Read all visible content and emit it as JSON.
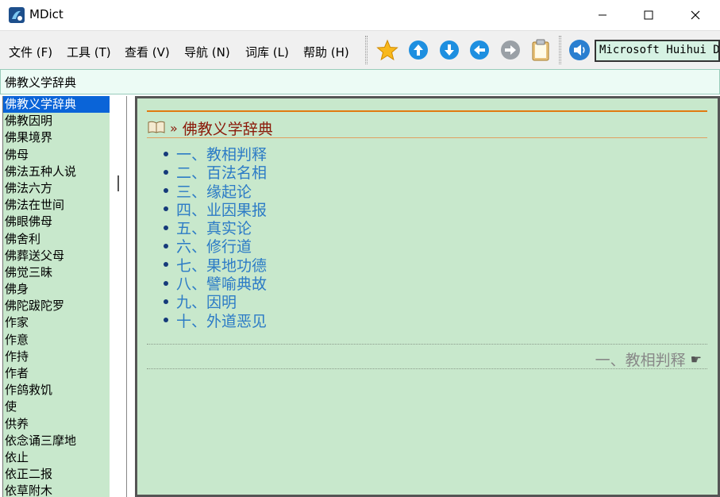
{
  "window": {
    "title": "MDict"
  },
  "menu": [
    {
      "label": "文件 (F)"
    },
    {
      "label": "工具 (T)"
    },
    {
      "label": "查看 (V)"
    },
    {
      "label": "导航 (N)"
    },
    {
      "label": "词库 (L)"
    },
    {
      "label": "帮助 (H)"
    }
  ],
  "toolbar": {
    "voice_value": "Microsoft Huihui Desktop",
    "icons": [
      "star-icon",
      "arrow-up-icon",
      "arrow-down-icon",
      "arrow-left-icon",
      "arrow-right-icon",
      "clipboard-icon",
      "speaker-icon"
    ]
  },
  "search": {
    "value": "佛教义学辞典"
  },
  "word_list": [
    "佛教义学辞典",
    "佛教因明",
    "佛果境界",
    "佛母",
    "佛法五种人说",
    "佛法六方",
    "佛法在世间",
    "佛眼佛母",
    "佛舍利",
    "佛葬送父母",
    "佛觉三昧",
    "佛身",
    "佛陀跋陀罗",
    "作家",
    "作意",
    "作持",
    "作者",
    "作鸽救饥",
    "使",
    "供养",
    "依念诵三摩地",
    "依止",
    "依正二报",
    "依草附木"
  ],
  "selected_index": 0,
  "entry": {
    "breadcrumb_sep": "»",
    "title": "佛教义学辞典",
    "toc": [
      "一、教相判释",
      "二、百法名相",
      "三、缘起论",
      "四、业因果报",
      "五、真实论",
      "六、修行道",
      "七、果地功德",
      "八、譬喻典故",
      "九、因明",
      "十、外道恶见"
    ],
    "next_link": "一、教相判释"
  },
  "colors": {
    "pane_bg": "#c8e8cc",
    "selected_bg": "#0a64d8",
    "link": "#2c7bc6",
    "heading": "#8b1a0a",
    "rule": "#e07a10"
  }
}
